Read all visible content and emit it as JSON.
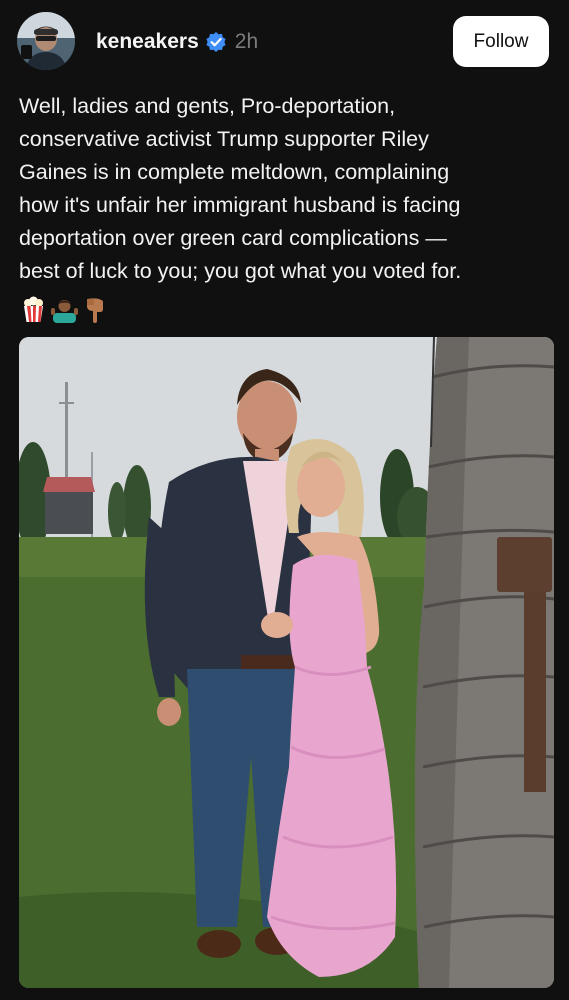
{
  "post": {
    "username": "keneakers",
    "timestamp": "2h",
    "follow_label": "Follow",
    "text": "Well, ladies and gents, Pro-deportation,\nconservative activist Trump supporter Riley\nGaines is in complete meltdown, complaining\nhow it's unfair her immigrant husband is facing\ndeportation over green card complications —\nbest of luck to you; you got what you voted for.",
    "emojis": [
      "popcorn-emoji",
      "person-shrugging-emoji",
      "backhand-index-pointing-down-emoji"
    ]
  },
  "icons": {
    "verified": "verified-badge-icon"
  },
  "colors": {
    "background": "#101010",
    "verified_blue": "#3f8ef7",
    "timestamp_gray": "#7b7b7b",
    "follow_button_bg": "#ffffff"
  }
}
